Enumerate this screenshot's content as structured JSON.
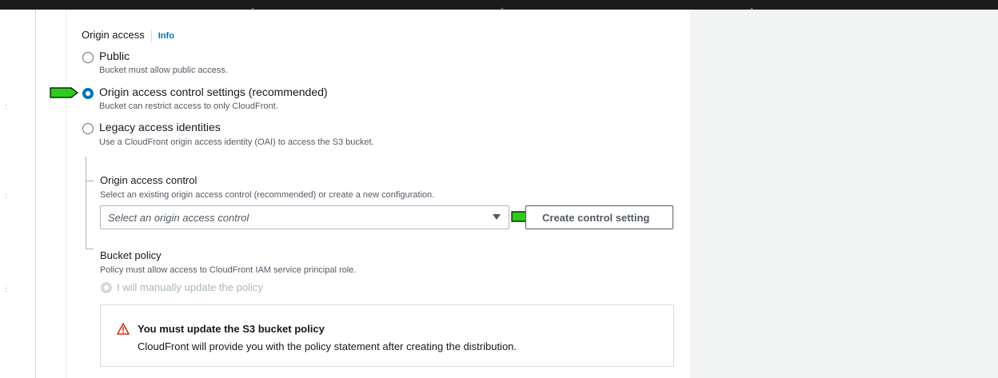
{
  "origin_access": {
    "label": "Origin access",
    "info_link": "Info",
    "options": [
      {
        "title": "Public",
        "description": "Bucket must allow public access.",
        "selected": false
      },
      {
        "title": "Origin access control settings (recommended)",
        "description": "Bucket can restrict access to only CloudFront.",
        "selected": true
      },
      {
        "title": "Legacy access identities",
        "description": "Use a CloudFront origin access identity (OAI) to access the S3 bucket.",
        "selected": false
      }
    ]
  },
  "origin_access_control": {
    "title": "Origin access control",
    "description": "Select an existing origin access control (recommended) or create a new configuration.",
    "select_placeholder": "Select an origin access control",
    "create_button": "Create control setting"
  },
  "bucket_policy": {
    "title": "Bucket policy",
    "description": "Policy must allow access to CloudFront IAM service principal role.",
    "option": "I will manually update the policy"
  },
  "alert": {
    "title": "You must update the S3 bucket policy",
    "body": "CloudFront will provide you with the policy statement after creating the distribution."
  },
  "colors": {
    "accent": "#0073bb",
    "pointer_fill": "#2ecc1a",
    "warning": "#d13212"
  }
}
